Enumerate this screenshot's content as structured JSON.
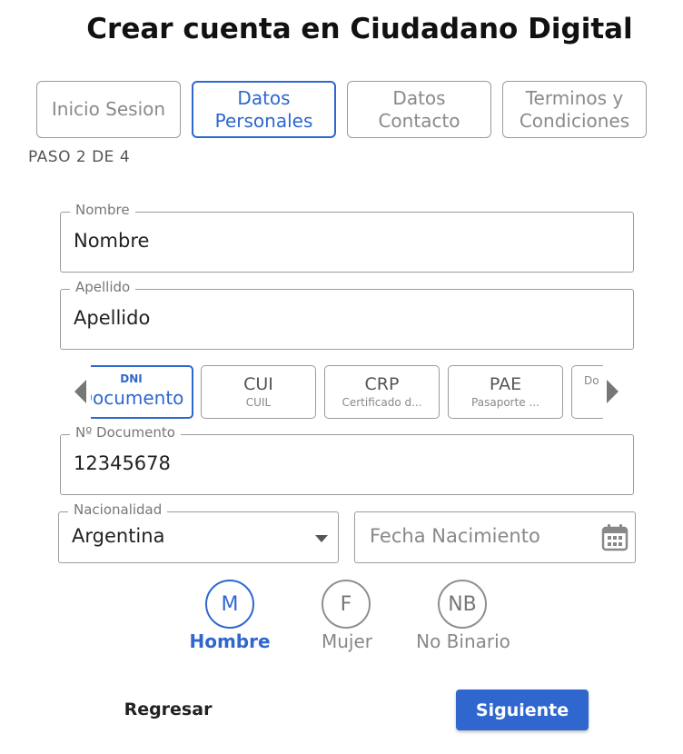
{
  "title": "Crear cuenta en Ciudadano Digital",
  "steps": [
    {
      "line1": "Inicio Sesion",
      "line2": ""
    },
    {
      "line1": "Datos",
      "line2": "Personales"
    },
    {
      "line1": "Datos",
      "line2": "Contacto"
    },
    {
      "line1": "Terminos y",
      "line2": "Condiciones"
    }
  ],
  "active_step": 2,
  "step_indicator": "PASO 2 DE 4",
  "fields": {
    "nombre": {
      "label": "Nombre",
      "value": "Nombre"
    },
    "apellido": {
      "label": "Apellido",
      "value": "Apellido"
    },
    "documento": {
      "label": "Nº Documento",
      "value": "12345678"
    },
    "nacionalidad": {
      "label": "Nacionalidad",
      "value": "Argentina"
    },
    "fecha": {
      "placeholder": "Fecha Nacimiento"
    }
  },
  "document_types": [
    {
      "code": "DNI",
      "name": "Documento"
    },
    {
      "code": "CUI",
      "name": "CUIL"
    },
    {
      "code": "CRP",
      "name": "Certificado d..."
    },
    {
      "code": "PAE",
      "name": "Pasaporte ..."
    },
    {
      "code": "",
      "name": "Do"
    }
  ],
  "genders": [
    {
      "initial": "M",
      "label": "Hombre"
    },
    {
      "initial": "F",
      "label": "Mujer"
    },
    {
      "initial": "NB",
      "label": "No Binario"
    }
  ],
  "selected_gender": "M",
  "buttons": {
    "back": "Regresar",
    "next": "Siguiente"
  },
  "colors": {
    "accent": "#2f67cf",
    "border": "#9a9a9a",
    "muted_text": "#888888"
  },
  "icons": {
    "calendar": "calendar-icon",
    "dropdown": "caret-down-icon",
    "prev": "chevron-left-icon",
    "next": "chevron-right-icon"
  }
}
